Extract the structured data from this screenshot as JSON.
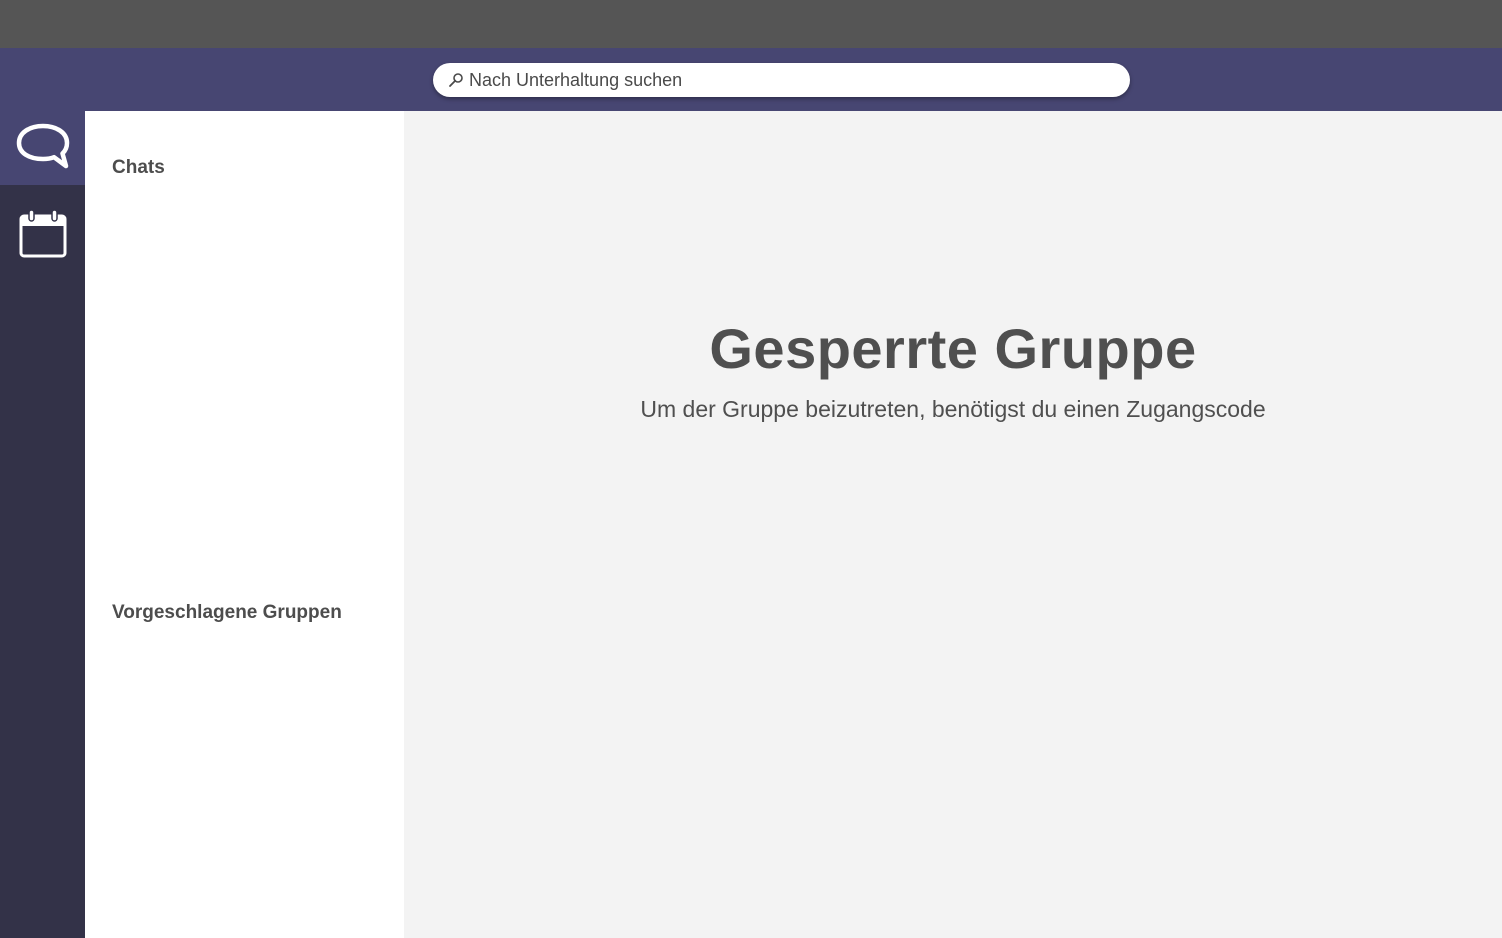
{
  "search": {
    "placeholder": "Nach Unterhaltung suchen",
    "icon": "magnifier-icon"
  },
  "nav_rail": {
    "items": [
      {
        "icon": "chat-bubble-icon",
        "active": true
      },
      {
        "icon": "calendar-icon",
        "active": false
      }
    ]
  },
  "sidebar": {
    "chats_heading": "Chats",
    "suggested_heading": "Vorgeschlagene Gruppen"
  },
  "main": {
    "title": "Gesperrte Gruppe",
    "subtitle": "Um der Gruppe beizutreten, benötigst du einen Zugangscode"
  },
  "colors": {
    "titlebar": "#555555",
    "topbar": "#474672",
    "rail": "#333248",
    "rail_active": "#474672",
    "sidebar": "#ffffff",
    "main_background": "#f3f3f3",
    "text": "#4f4f4f"
  }
}
